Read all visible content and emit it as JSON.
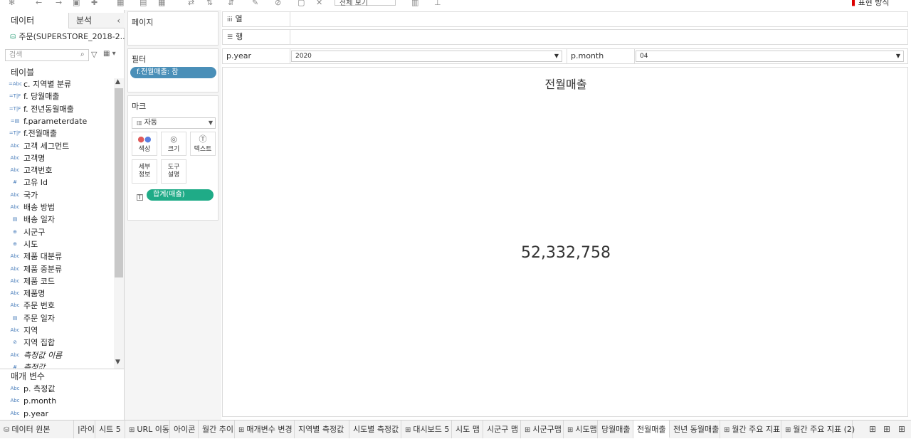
{
  "toolbar": {
    "show_me_dropdown": "전체 보기",
    "show_me_label": "표현 방식"
  },
  "data_pane": {
    "tabs": [
      {
        "label": "데이터"
      },
      {
        "label": "분석"
      }
    ],
    "collapse_icon": "chevron-left-icon",
    "datasource": "주문(SUPERSTORE_2018-2...",
    "search_placeholder": "검색",
    "tables_title": "테이블",
    "fields": [
      {
        "icon": "=Abc",
        "label": "c. 지역별 분류"
      },
      {
        "icon": "=T|F",
        "label": "f. 당월매출"
      },
      {
        "icon": "=T|F",
        "label": "f. 전년동월매출"
      },
      {
        "icon": "=▤",
        "label": "f.parameterdate"
      },
      {
        "icon": "=T|F",
        "label": "f.전월매출"
      },
      {
        "icon": "Abc",
        "label": "고객 세그먼트"
      },
      {
        "icon": "Abc",
        "label": "고객명"
      },
      {
        "icon": "Abc",
        "label": "고객번호"
      },
      {
        "icon": "#",
        "label": "고유 Id"
      },
      {
        "icon": "Abc",
        "label": "국가"
      },
      {
        "icon": "Abc",
        "label": "배송 방법"
      },
      {
        "icon": "▤",
        "label": "배송 일자"
      },
      {
        "icon": "⊕",
        "label": "시군구"
      },
      {
        "icon": "⊕",
        "label": "시도"
      },
      {
        "icon": "Abc",
        "label": "제품 대분류"
      },
      {
        "icon": "Abc",
        "label": "제품 중분류"
      },
      {
        "icon": "Abc",
        "label": "제품 코드"
      },
      {
        "icon": "Abc",
        "label": "제품명"
      },
      {
        "icon": "Abc",
        "label": "주문 번호"
      },
      {
        "icon": "▤",
        "label": "주문 일자"
      },
      {
        "icon": "Abc",
        "label": "지역"
      },
      {
        "icon": "⊘",
        "label": "지역 집합"
      },
      {
        "icon": "Abc",
        "label": "측정값 이름",
        "italic": true
      },
      {
        "icon": "#",
        "label": "측정값",
        "italic": true
      }
    ],
    "params_title": "매개 변수",
    "params": [
      {
        "icon": "Abc",
        "label": "p. 측정값"
      },
      {
        "icon": "Abc",
        "label": "p.month"
      },
      {
        "icon": "Abc",
        "label": "p.year"
      }
    ]
  },
  "pages_card": {
    "title": "페이지"
  },
  "filters_card": {
    "title": "필터",
    "pill": "f.전월매출: 참"
  },
  "marks_card": {
    "title": "마크",
    "type": "자동",
    "buttons": [
      {
        "label": "색상",
        "icon": "color-dots-icon"
      },
      {
        "label": "크기",
        "icon": "size-icon"
      },
      {
        "label": "텍스트",
        "icon": "text-icon"
      },
      {
        "label1": "세부",
        "label2": "정보"
      },
      {
        "label1": "도구",
        "label2": "설명"
      }
    ],
    "pill": "합계(매출)"
  },
  "shelves": {
    "columns_label": "열",
    "rows_label": "행"
  },
  "params_bar": {
    "year_label": "p.year",
    "year_value": "2020",
    "month_label": "p.month",
    "month_value": "04"
  },
  "viz": {
    "title": "전월매출",
    "value": "52,332,758"
  },
  "bottom_tabs": [
    {
      "label": "데이터 원본",
      "icon": "datasource-icon"
    },
    {
      "label": "|라이"
    },
    {
      "label": "시트 5"
    },
    {
      "label": "URL 이동",
      "icon": "dashboard-icon"
    },
    {
      "label": "아이콘"
    },
    {
      "label": "월간 추이"
    },
    {
      "label": "매개변수 변경",
      "icon": "dashboard-icon"
    },
    {
      "label": "지역별 측정값"
    },
    {
      "label": "시도별 측정값"
    },
    {
      "label": "대시보드 5",
      "icon": "dashboard-icon"
    },
    {
      "label": "시도 맵"
    },
    {
      "label": "시군구 맵"
    },
    {
      "label": "시군구맵",
      "icon": "dashboard-icon"
    },
    {
      "label": "시도맵",
      "icon": "dashboard-icon"
    },
    {
      "label": "당월매출"
    },
    {
      "label": "전월매출",
      "active": true
    },
    {
      "label": "전년 동월매출"
    },
    {
      "label": "월간 주요 지표",
      "icon": "dashboard-icon"
    },
    {
      "label": "월간 주요 지표 (2)",
      "icon": "dashboard-icon"
    }
  ]
}
